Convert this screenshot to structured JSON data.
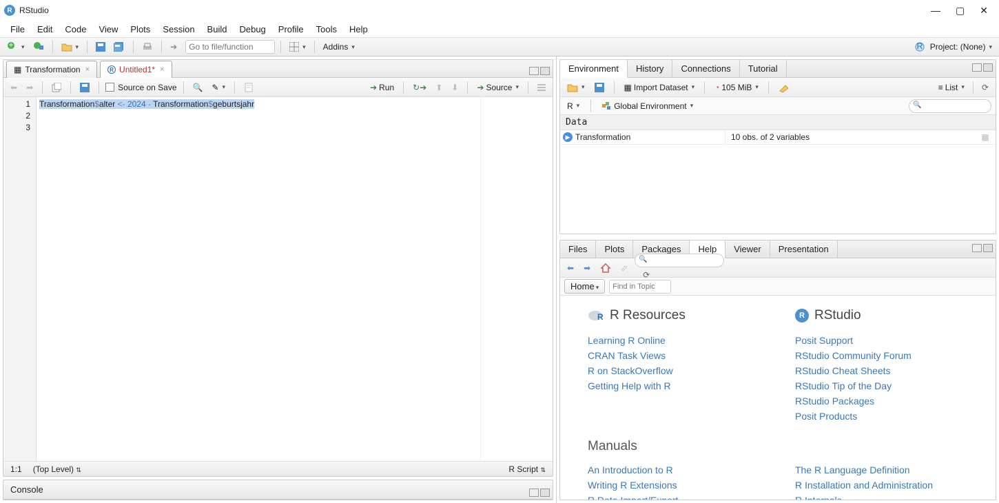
{
  "app": {
    "title": "RStudio"
  },
  "menu": [
    "File",
    "Edit",
    "Code",
    "View",
    "Plots",
    "Session",
    "Build",
    "Debug",
    "Profile",
    "Tools",
    "Help"
  ],
  "maintool": {
    "goto_placeholder": "Go to file/function",
    "addins": "Addins",
    "project": "Project: (None)"
  },
  "source": {
    "tabs": [
      {
        "label": "Transformation"
      },
      {
        "label": "Untitled1*"
      }
    ],
    "toolbar": {
      "source_on_save": "Source on Save",
      "run": "Run",
      "source": "Source"
    },
    "lines": [
      "1",
      "2",
      "3"
    ],
    "code_parts": {
      "a": "Transformation",
      "b": "$",
      "c": "alter",
      "d": " <- ",
      "e": "2024",
      "f": " - ",
      "g": "Transformation",
      "h": "$",
      "i": "geburtsjahr"
    },
    "status": {
      "pos": "1:1",
      "scope": "(Top Level)",
      "lang": "R Script"
    }
  },
  "console": {
    "title": "Console"
  },
  "env": {
    "tabs": [
      "Environment",
      "History",
      "Connections",
      "Tutorial"
    ],
    "import": "Import Dataset",
    "mem": "105 MiB",
    "list": "List",
    "scope_r": "R",
    "scope_env": "Global Environment",
    "hdr": "Data",
    "row": {
      "name": "Transformation",
      "desc": "10 obs. of 2 variables"
    }
  },
  "help": {
    "tabs": [
      "Files",
      "Plots",
      "Packages",
      "Help",
      "Viewer",
      "Presentation"
    ],
    "home": "Home",
    "find_placeholder": "Find in Topic",
    "col1": {
      "title": "R Resources",
      "links": [
        "Learning R Online",
        "CRAN Task Views",
        "R on StackOverflow",
        "Getting Help with R"
      ]
    },
    "col2": {
      "title": "RStudio",
      "links": [
        "Posit Support",
        "RStudio Community Forum",
        "RStudio Cheat Sheets",
        "RStudio Tip of the Day",
        "RStudio Packages",
        "Posit Products"
      ]
    },
    "manuals": {
      "title": "Manuals",
      "left": [
        "An Introduction to R",
        "Writing R Extensions",
        "R Data Import/Export"
      ],
      "right": [
        "The R Language Definition",
        "R Installation and Administration",
        "R Internals"
      ]
    }
  }
}
